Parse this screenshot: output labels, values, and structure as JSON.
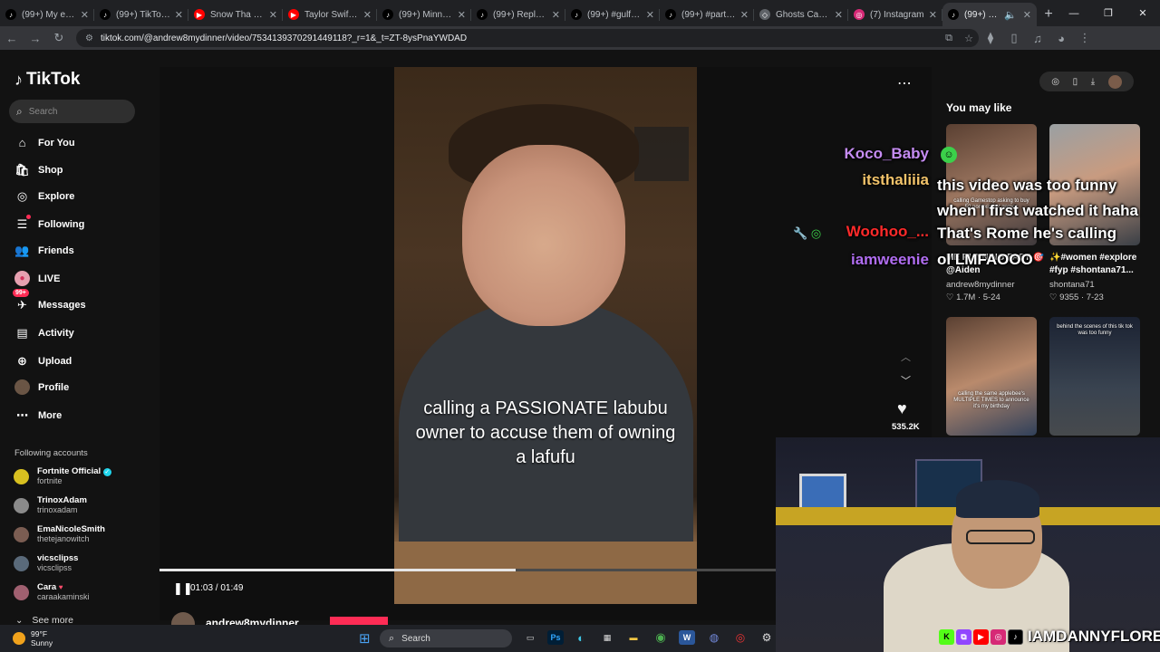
{
  "browser": {
    "tabs": [
      {
        "label": "(99+) My ex of",
        "favicon": "tiktok",
        "active": false
      },
      {
        "label": "(99+) TikTok - M",
        "favicon": "tiktok",
        "active": false
      },
      {
        "label": "Snow Tha Prod",
        "favicon": "youtube",
        "active": false
      },
      {
        "label": "Taylor Swift on",
        "favicon": "youtube",
        "active": false
      },
      {
        "label": "(99+) Minnesota",
        "favicon": "tiktok",
        "active": false
      },
      {
        "label": "(99+) Replying t",
        "favicon": "tiktok",
        "active": false
      },
      {
        "label": "(99+) #gulfcoa",
        "favicon": "tiktok",
        "active": false
      },
      {
        "label": "(99+) #part2 #",
        "favicon": "tiktok",
        "active": false
      },
      {
        "label": "Ghosts Caught",
        "favicon": "generic",
        "active": false
      },
      {
        "label": "(7) Instagram",
        "favicon": "instagram",
        "active": false
      },
      {
        "label": "(99+) Defe",
        "favicon": "tiktok",
        "active": true
      }
    ],
    "url": "tiktok.com/@andrew8mydinner/video/7534139370291449118?_r=1&_t=ZT-8ysPnaYWDAD"
  },
  "sidebar": {
    "logo": "TikTok",
    "search_placeholder": "Search",
    "nav": [
      {
        "label": "For You",
        "icon": "home-icon",
        "glyph": "⌂"
      },
      {
        "label": "Shop",
        "icon": "shopping-bag-icon",
        "glyph": "🛍"
      },
      {
        "label": "Explore",
        "icon": "compass-icon",
        "glyph": "◎"
      },
      {
        "label": "Following",
        "icon": "following-icon",
        "glyph": "☰"
      },
      {
        "label": "Friends",
        "icon": "friends-icon",
        "glyph": "👥"
      },
      {
        "label": "LIVE",
        "icon": "live-icon",
        "glyph": "●"
      },
      {
        "label": "Messages",
        "icon": "messages-icon",
        "glyph": "✈"
      },
      {
        "label": "Activity",
        "icon": "activity-icon",
        "glyph": "▤"
      },
      {
        "label": "Upload",
        "icon": "upload-icon",
        "glyph": "⊕"
      },
      {
        "label": "Profile",
        "icon": "profile-icon",
        "glyph": "◉"
      },
      {
        "label": "More",
        "icon": "more-dots-icon",
        "glyph": "⋯"
      }
    ],
    "messages_badge": "99+",
    "following_accounts_title": "Following accounts",
    "accounts": [
      {
        "name": "Fortnite Official",
        "handle": "fortnite",
        "verified": true,
        "color": "#d8c020"
      },
      {
        "name": "TrinoxAdam",
        "handle": "trinoxadam",
        "verified": false,
        "color": "#8a8a8a"
      },
      {
        "name": "EmaNicoleSmith",
        "handle": "thetejanowitch",
        "verified": false,
        "color": "#7b5d52"
      },
      {
        "name": "vicsclipss",
        "handle": "vicsclipss",
        "verified": false,
        "color": "#5a6a7a"
      },
      {
        "name": "Cara",
        "handle": "caraakaminski",
        "verified": false,
        "color": "#a06070"
      }
    ],
    "see_more": "See more"
  },
  "video": {
    "caption": "calling a PASSIONATE labubu owner to accuse them of owning a lafufu",
    "likes": "535.2K",
    "time": "01:03 / 01:49",
    "progress": 0.578,
    "author": "andrew8mydinner"
  },
  "recommend": {
    "title": "You may like",
    "cards": [
      {
        "title": "ME RUNNING FAST 🎯 @Aiden",
        "user": "andrew8mydinner",
        "stats": "1.7M · 5-24",
        "thumb_text": "calling Gamestop asking to buy 50 nonexistent games"
      },
      {
        "title": "✨#women #explore #fyp #shontana71...",
        "user": "shontana71",
        "stats": "9355 · 7-23",
        "thumb_text": ""
      },
      {
        "title": "",
        "user": "",
        "stats": "",
        "thumb_text": "calling the same applebee's MULTIPLE TIMES to announce it's my birthday"
      },
      {
        "title": "",
        "user": "",
        "stats": "",
        "thumb_text": "behind the scenes of this tik tok was too funny"
      }
    ]
  },
  "chat": [
    {
      "user": "Koco_Baby",
      "color": "#c58cf2",
      "message": ""
    },
    {
      "user": "itsthaliiia",
      "color": "#f2c36a",
      "message": "this video was too funny when I first watched it haha"
    },
    {
      "user": "Woohoo_...",
      "color": "#ff2a2a",
      "message": "That's Rome he's calling"
    },
    {
      "user": "iamweenie",
      "color": "#b06df0",
      "message": "ol LMFAOOO"
    }
  ],
  "streamer": {
    "handle": "IAMDANNYFLORES"
  },
  "taskbar": {
    "weather_temp": "99°F",
    "weather_cond": "Sunny",
    "search": "Search"
  }
}
